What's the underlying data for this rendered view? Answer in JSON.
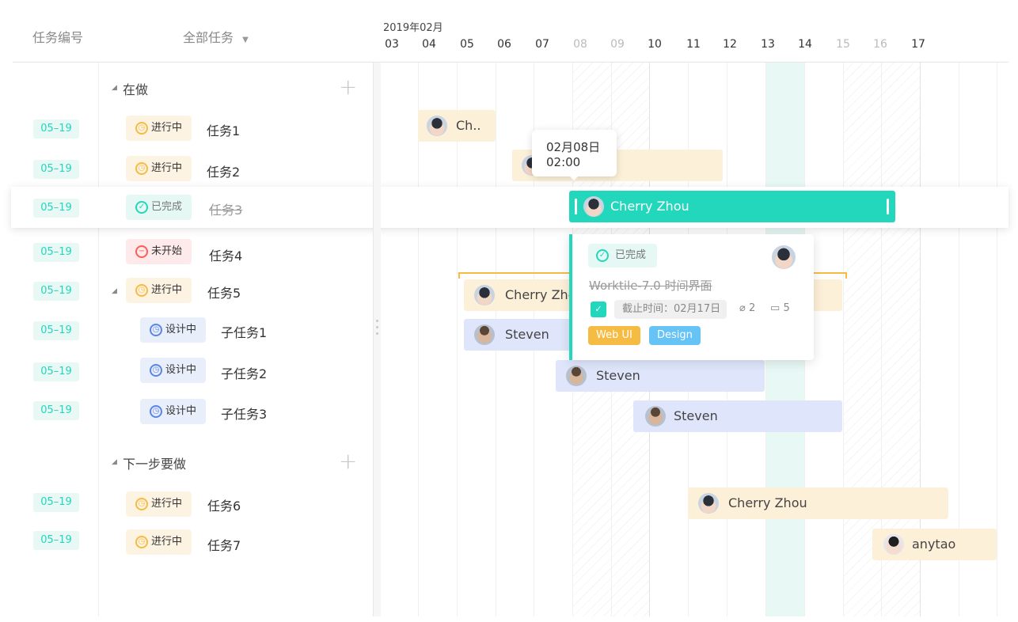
{
  "header": {
    "col_task_no": "任务编号",
    "col_filter": "全部任务",
    "month": "2019年02月",
    "days": [
      "03",
      "04",
      "05",
      "06",
      "07",
      "08",
      "09",
      "10",
      "11",
      "12",
      "13",
      "14",
      "15",
      "16",
      "17"
    ]
  },
  "groups": [
    {
      "title": "在做"
    },
    {
      "title": "下一步要做"
    }
  ],
  "rows": [
    {
      "date": "05–19",
      "status": "进行中",
      "name": "任务1"
    },
    {
      "date": "05–19",
      "status": "进行中",
      "name": "任务2"
    },
    {
      "date": "05–19",
      "status": "已完成",
      "name": "任务3"
    },
    {
      "date": "05–19",
      "status": "未开始",
      "name": "任务4"
    },
    {
      "date": "05–19",
      "status": "进行中",
      "name": "任务5"
    },
    {
      "date": "05–19",
      "status": "设计中",
      "name": "子任务1"
    },
    {
      "date": "05–19",
      "status": "设计中",
      "name": "子任务2"
    },
    {
      "date": "05–19",
      "status": "设计中",
      "name": "子任务3"
    },
    {
      "date": "05–19",
      "status": "进行中",
      "name": "任务6"
    },
    {
      "date": "05–19",
      "status": "进行中",
      "name": "任务7"
    }
  ],
  "bars": [
    {
      "assignee": "Ch..",
      "avatar": "female-avatar"
    },
    {
      "assignee": "",
      "avatar": "female-avatar"
    },
    {
      "assignee": "Cherry Zhou",
      "avatar": "female-avatar"
    },
    {
      "assignee": "Cherry Zhou",
      "avatar": "female-avatar"
    },
    {
      "assignee": "Steven",
      "avatar": "male-avatar"
    },
    {
      "assignee": "Steven",
      "avatar": "male-avatar"
    },
    {
      "assignee": "Steven",
      "avatar": "male-avatar"
    },
    {
      "assignee": "Cherry Zhou",
      "avatar": "female-avatar"
    },
    {
      "assignee": "anytao",
      "avatar": "female-avatar"
    }
  ],
  "tooltip": {
    "date": "02月08日",
    "time": "02:00"
  },
  "card": {
    "status": "已完成",
    "title": "Worktile-7.0 时间界面",
    "due": "截止时间：02月17日",
    "attachments": "2",
    "comments": "5",
    "tags": [
      {
        "label": "Web UI",
        "color": "#f6bb42"
      },
      {
        "label": "Design",
        "color": "#66c3f6"
      }
    ]
  },
  "colors": {
    "accent": "#22d7bb",
    "doing": "#f6bb42",
    "todo": "#ff5b57",
    "design": "#5a85e8"
  }
}
